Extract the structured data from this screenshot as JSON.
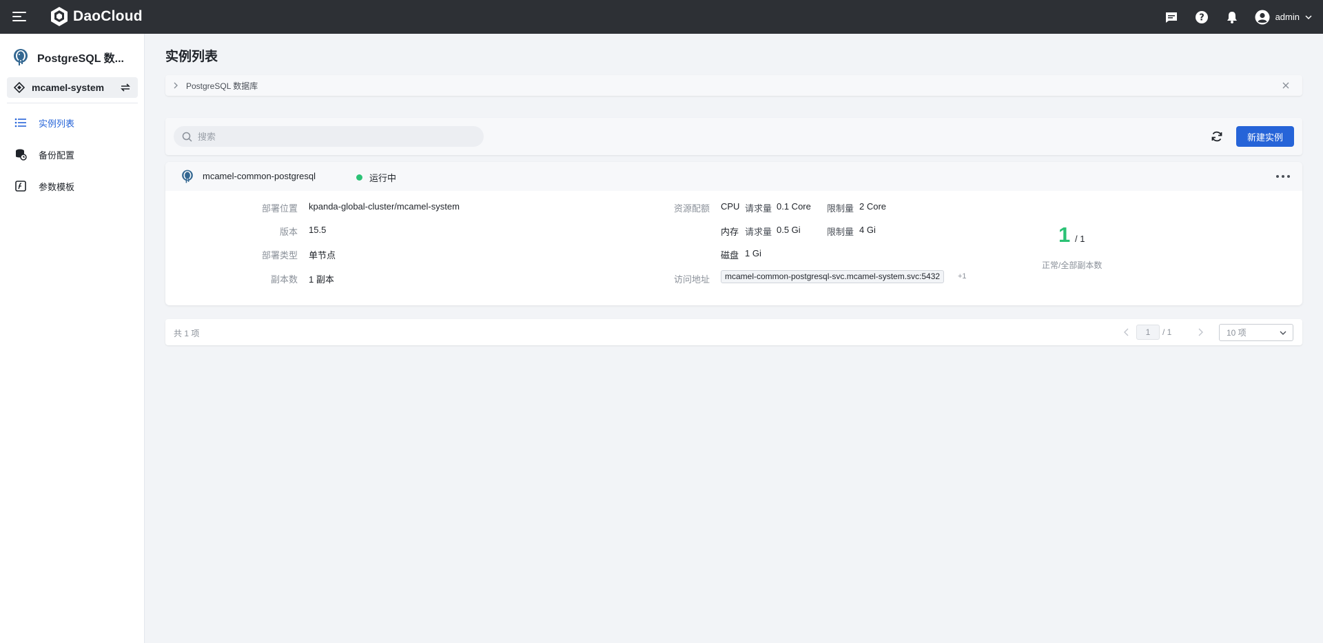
{
  "header": {
    "brand": "DaoCloud",
    "user": "admin",
    "icons": [
      "menu-icon",
      "message-icon",
      "help-icon",
      "bell-icon",
      "user-avatar-icon",
      "chevron-down-icon"
    ]
  },
  "sidebar": {
    "title": "PostgreSQL 数...",
    "namespace": "mcamel-system",
    "items": [
      {
        "label": "实例列表",
        "icon": "list-icon",
        "active": true
      },
      {
        "label": "备份配置",
        "icon": "backup-icon",
        "active": false
      },
      {
        "label": "参数模板",
        "icon": "template-icon",
        "active": false
      }
    ]
  },
  "main": {
    "title": "实例列表",
    "breadcrumb": "PostgreSQL 数据库",
    "search_placeholder": "搜索",
    "new_button": "新建实例",
    "instance": {
      "name": "mcamel-common-postgresql",
      "status": "运行中",
      "status_color": "#2bc275",
      "fields": {
        "location_label": "部署位置",
        "location": "kpanda-global-cluster/mcamel-system",
        "version_label": "版本",
        "version": "15.5",
        "type_label": "部署类型",
        "type": "单节点",
        "replicas_label": "副本数",
        "replicas": "1 副本",
        "quota_label": "资源配额",
        "cpu_label": "CPU",
        "request_label": "请求量",
        "limit_label": "限制量",
        "cpu_request": "0.1 Core",
        "cpu_limit": "2 Core",
        "mem_label": "内存",
        "mem_request": "0.5 Gi",
        "mem_limit": "4 Gi",
        "disk_label": "磁盘",
        "disk": "1 Gi",
        "address_label": "访问地址",
        "address": "mcamel-common-postgresql-svc.mcamel-system.svc:5432",
        "address_more": "+1"
      },
      "replica_ready": "1",
      "replica_total": "/ 1",
      "replica_caption": "正常/全部副本数"
    },
    "pagination": {
      "total": "共 1 项",
      "page": "1",
      "of": "/ 1",
      "page_size": "10 项"
    }
  },
  "colors": {
    "accent": "#2664d8",
    "topbar": "#2d3035",
    "success": "#2bc275"
  }
}
